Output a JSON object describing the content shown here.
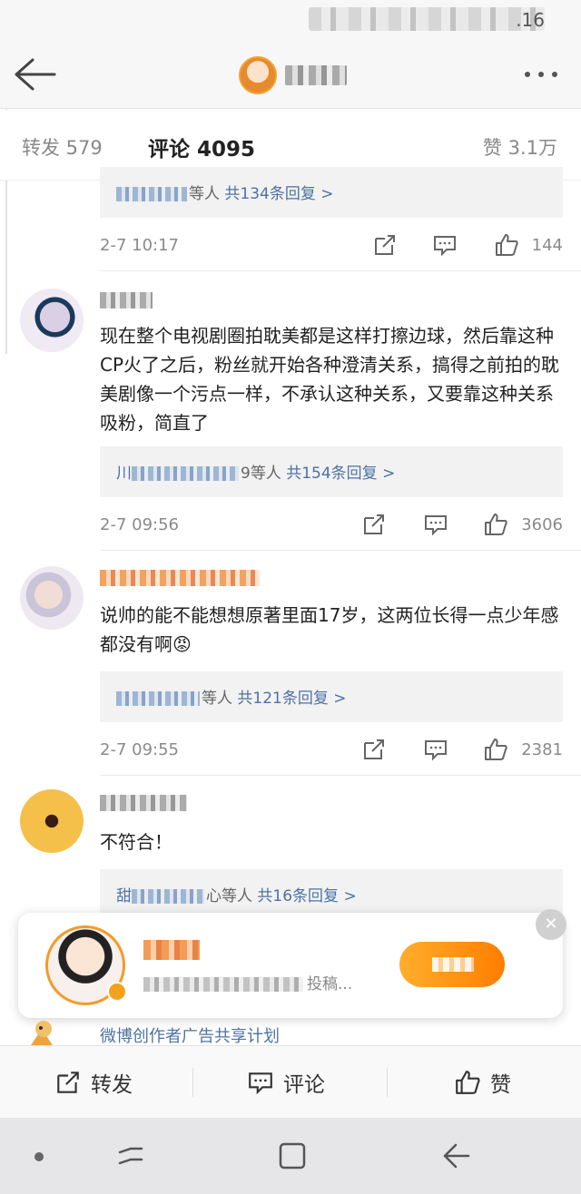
{
  "status_bar": {
    "time": ".16"
  },
  "nav": {
    "title_blurred": true
  },
  "tabs": {
    "forward": "转发 579",
    "comments": "评论 4095",
    "likes": "赞 3.1万"
  },
  "comments": [
    {
      "reply_suffix": "等人",
      "reply_link": "共134条回复 >",
      "time": "2-7 10:17",
      "likes": "144"
    },
    {
      "text": "现在整个电视剧圈拍耽美都是这样打擦边球，然后靠这种CP火了之后，粉丝就开始各种澄清关系，搞得之前拍的耽美剧像一个污点一样，不承认这种关系，又要靠这种关系吸粉，简直了",
      "reply_prefix": "川",
      "reply_suffix": "9等人",
      "reply_link": "共154条回复 >",
      "time": "2-7 09:56",
      "likes": "3606"
    },
    {
      "text": "说帅的能不能想想原著里面17岁，这两位长得一点少年感都没有啊😡",
      "reply_suffix": "等人",
      "reply_link": "共121条回复 >",
      "time": "2-7 09:55",
      "likes": "2381"
    },
    {
      "text": "不符合！",
      "reply_prefix": "甜",
      "reply_suffix": "心等人",
      "reply_link": "共16条回复 >"
    }
  ],
  "popup": {
    "subtitle_tail": "投稿..."
  },
  "ad": {
    "text": "微博创作者广告共享计划"
  },
  "bottom_bar": {
    "forward": "转发",
    "comment": "评论",
    "like": "赞"
  }
}
